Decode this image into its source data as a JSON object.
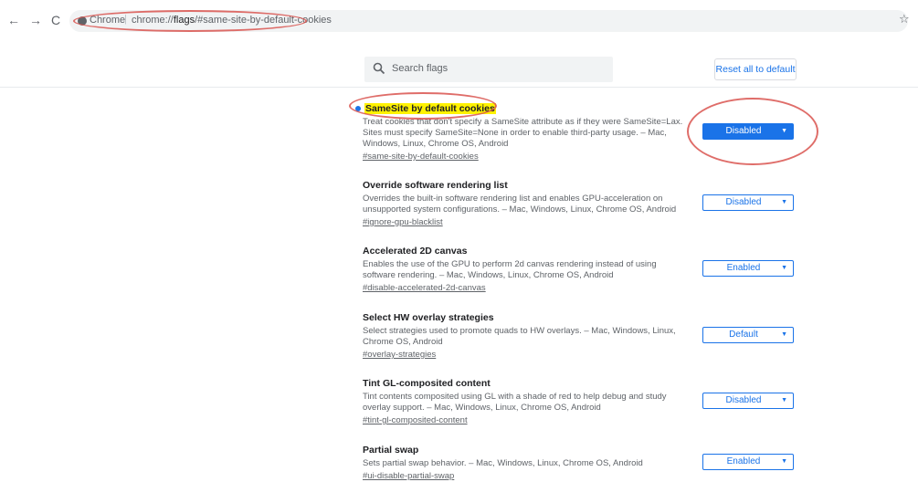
{
  "browser": {
    "back_glyph": "←",
    "forward_glyph": "→",
    "reload_glyph": "C",
    "scheme_label": "Chrome",
    "separator": "|",
    "url_host": "chrome://",
    "url_flags": "flags",
    "url_fragment": "/#same-site-by-default-cookies",
    "star_glyph": "☆"
  },
  "header": {
    "search_placeholder": "Search flags",
    "reset_label": "Reset all to default"
  },
  "experiments": [
    {
      "title": "SameSite by default cookies",
      "description": "Treat cookies that don't specify a SameSite attribute as if they were SameSite=Lax. Sites must specify SameSite=None in order to enable third-party usage. – Mac, Windows, Linux, Chrome OS, Android",
      "link": "#same-site-by-default-cookies",
      "value": "Disabled"
    },
    {
      "title": "Override software rendering list",
      "description": "Overrides the built-in software rendering list and enables GPU-acceleration on unsupported system configurations. – Mac, Windows, Linux, Chrome OS, Android",
      "link": "#ignore-gpu-blacklist",
      "value": "Disabled"
    },
    {
      "title": "Accelerated 2D canvas",
      "description": "Enables the use of the GPU to perform 2d canvas rendering instead of using software rendering. – Mac, Windows, Linux, Chrome OS, Android",
      "link": "#disable-accelerated-2d-canvas",
      "value": "Enabled"
    },
    {
      "title": "Select HW overlay strategies",
      "description": "Select strategies used to promote quads to HW overlays. – Mac, Windows, Linux, Chrome OS, Android",
      "link": "#overlay-strategies",
      "value": "Default"
    },
    {
      "title": "Tint GL-composited content",
      "description": "Tint contents composited using GL with a shade of red to help debug and study overlay support. – Mac, Windows, Linux, Chrome OS, Android",
      "link": "#tint-gl-composited-content",
      "value": "Disabled"
    },
    {
      "title": "Partial swap",
      "description": "Sets partial swap behavior. – Mac, Windows, Linux, Chrome OS, Android",
      "link": "#ui-disable-partial-swap",
      "value": "Enabled"
    }
  ],
  "dropdown_glyph": "▼",
  "colors": {
    "accent": "#1a73e8",
    "highlight": "#fff200",
    "annotation": "#d9534f"
  }
}
